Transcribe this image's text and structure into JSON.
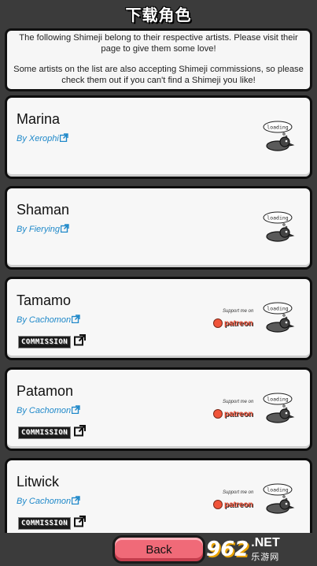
{
  "header": {
    "title": "下载角色"
  },
  "notice": {
    "line1": "The following Shimeji belong to their respective artists. Please visit their page to give them some love!",
    "line2": "Some artists on the list are also accepting Shimeji commissions, so please check them out if you can't find a Shimeji you like!"
  },
  "cards": [
    {
      "name": "Marina",
      "artist": "By Xerophi",
      "commission": false,
      "patreon": false
    },
    {
      "name": "Shaman",
      "artist": "By Fierying",
      "commission": false,
      "patreon": false
    },
    {
      "name": "Tamamo",
      "artist": "By Cachomon",
      "commission": true,
      "patreon": true
    },
    {
      "name": "Patamon",
      "artist": "By Cachomon",
      "commission": true,
      "patreon": true
    },
    {
      "name": "Litwick",
      "artist": "By Cachomon",
      "commission": true,
      "patreon": true
    }
  ],
  "labels": {
    "commission": "COMMISSION",
    "loading": "loading",
    "patreon_top": "Support me on",
    "patreon_word": "patreon"
  },
  "footer": {
    "back_label": "Back"
  },
  "watermark": {
    "number": "962",
    "net": ".NET",
    "cn": "乐游网"
  },
  "colors": {
    "background": "#3b3b3b",
    "link": "#1e88c9",
    "back_button": "#f06a78",
    "patreon": "#f0543a"
  }
}
